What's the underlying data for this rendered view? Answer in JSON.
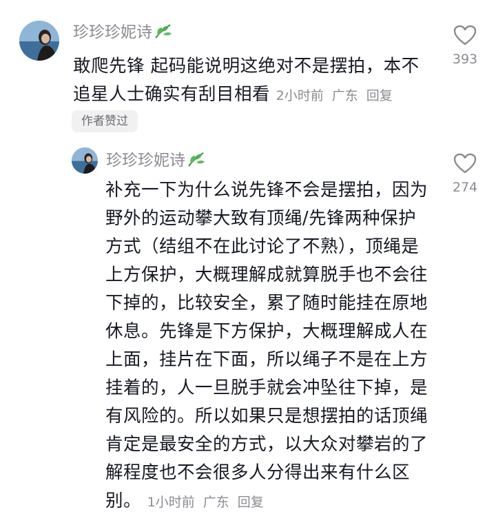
{
  "comments": [
    {
      "username": "珍珍珍妮诗",
      "text": "敢爬先锋 起码能说明这绝对不是摆拍，本不追星人士确实有刮目相看",
      "time": "2小时前",
      "location": "广东",
      "reply_label": "回复",
      "badge": "作者赞过",
      "likes": "393"
    },
    {
      "username": "珍珍珍妮诗",
      "text": "补充一下为什么说先锋不会是摆拍，因为野外的运动攀大致有顶绳/先锋两种保护方式（结组不在此讨论了不熟），顶绳是上方保护，大概理解成就算脱手也不会往下掉的，比较安全，累了随时能挂在原地休息。先锋是下方保护，大概理解成人在上面，挂片在下面，所以绳子不是在上方挂着的，人一旦脱手就会冲坠往下掉，是有风险的。所以如果只是想摆拍的话顶绳肯定是最安全的方式，以大众对攀岩的了解程度也不会很多人分得出来有什么区别。",
      "time": "1小时前",
      "location": "广东",
      "reply_label": "回复",
      "likes": "274"
    }
  ],
  "icons": {
    "like": "heart-outline-icon",
    "badge": "leaf-icon"
  },
  "colors": {
    "primary_text": "#161823",
    "secondary_text": "#8a8b91",
    "badge_bg": "#f1f1f2",
    "leaf": "#4caf50"
  }
}
